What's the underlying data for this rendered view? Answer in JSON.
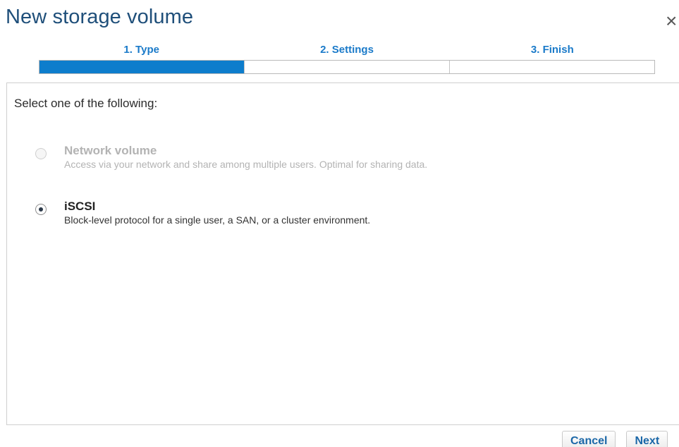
{
  "dialog": {
    "title": "New storage volume",
    "close_glyph": "×"
  },
  "steps": [
    {
      "label": "1. Type",
      "active": true
    },
    {
      "label": "2. Settings",
      "active": false
    },
    {
      "label": "3. Finish",
      "active": false
    }
  ],
  "progress": {
    "completed_steps": 1,
    "total_steps": 3
  },
  "content": {
    "prompt": "Select one of the following:",
    "options": [
      {
        "title": "Network volume",
        "description": "Access via your network and share among multiple users. Optimal for sharing data.",
        "state": "disabled",
        "selected": false
      },
      {
        "title": "iSCSI",
        "description": "Block-level protocol for a single user, a SAN, or a cluster environment.",
        "state": "enabled",
        "selected": true
      }
    ]
  },
  "footer": {
    "cancel_label": "Cancel",
    "next_label": "Next"
  },
  "colors": {
    "title": "#1f4f7a",
    "accent": "#0d7dcc",
    "step_label": "#1a7ac9",
    "disabled_text": "#b3b3b3",
    "button_text": "#1a67a8"
  }
}
